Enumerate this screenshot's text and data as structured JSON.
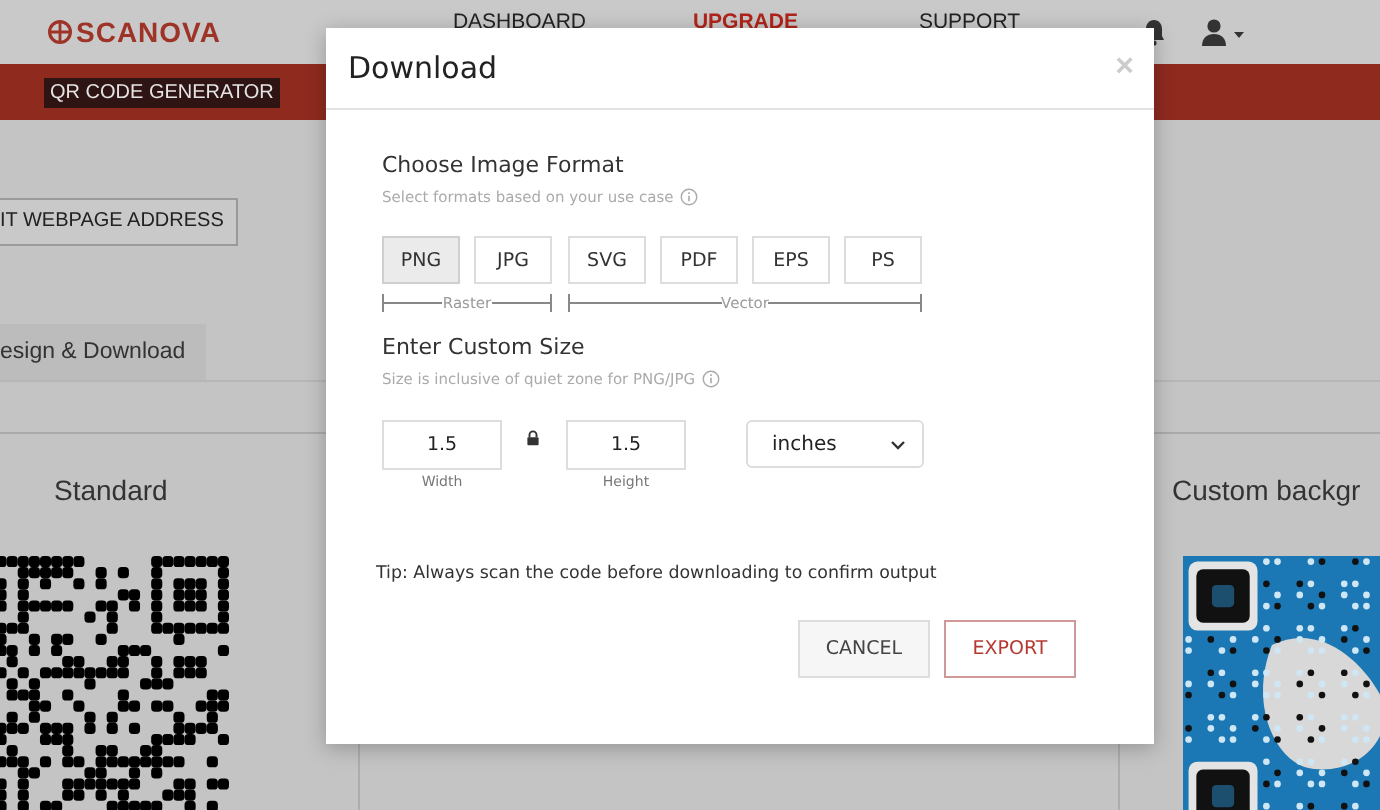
{
  "header": {
    "logo": "SCANOVA",
    "nav": [
      {
        "label": "DASHBOARD",
        "selected": false
      },
      {
        "label": "UPGRADE",
        "selected": true
      },
      {
        "label": "SUPPORT",
        "selected": false
      }
    ]
  },
  "title_bar": {
    "title": "QR CODE GENERATOR"
  },
  "edit_button": "IT WEBPAGE ADDRESS",
  "tab": {
    "label": "esign & Download"
  },
  "cards": [
    {
      "title": "Standard",
      "kind": "plain"
    },
    {
      "title": "Custom backgr",
      "kind": "background"
    }
  ],
  "dialog": {
    "title": "Download",
    "close": "×",
    "format_heading": "Choose Image Format",
    "format_hint": "Select formats based on your use case",
    "format_groups": [
      {
        "label": "Raster",
        "formats": [
          {
            "label": "PNG",
            "selected": true
          },
          {
            "label": "JPG",
            "selected": false
          }
        ]
      },
      {
        "label": "Vector",
        "formats": [
          {
            "label": "SVG",
            "selected": false
          },
          {
            "label": "PDF",
            "selected": false
          },
          {
            "label": "EPS",
            "selected": false
          },
          {
            "label": "PS",
            "selected": false
          }
        ]
      }
    ],
    "size_heading": "Enter Custom Size",
    "size_hint": "Size is inclusive of quiet zone for PNG/JPG",
    "width": {
      "value": "1.5",
      "label": "Width"
    },
    "height": {
      "value": "1.5",
      "label": "Height"
    },
    "unit": "inches",
    "tip": "Tip: Always scan the code before downloading to confirm output",
    "buttons": [
      {
        "label": "CANCEL",
        "kind": "secondary"
      },
      {
        "label": "EXPORT",
        "kind": "primary"
      }
    ]
  }
}
